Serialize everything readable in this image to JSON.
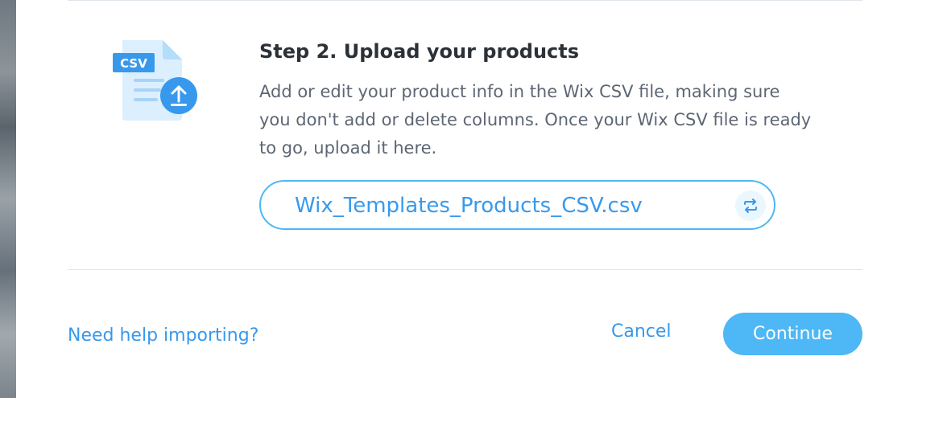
{
  "step": {
    "title": "Step 2. Upload your products",
    "description": "Add or edit your product info in the Wix CSV file, making sure you don't add or delete columns. Once your Wix CSV file is ready to go, upload it here."
  },
  "illustration": {
    "badge": "CSV",
    "icon": "csv-upload-icon"
  },
  "file": {
    "name": "Wix_Templates_Products_CSV.csv",
    "replace_icon": "replace-arrows-icon"
  },
  "footer": {
    "help_link": "Need help importing?",
    "cancel_label": "Cancel",
    "continue_label": "Continue"
  },
  "colors": {
    "accent": "#3899ec",
    "button": "#4eb7f5",
    "title": "#2b3137",
    "text": "#5d6673",
    "divider": "#dfe5eb"
  }
}
